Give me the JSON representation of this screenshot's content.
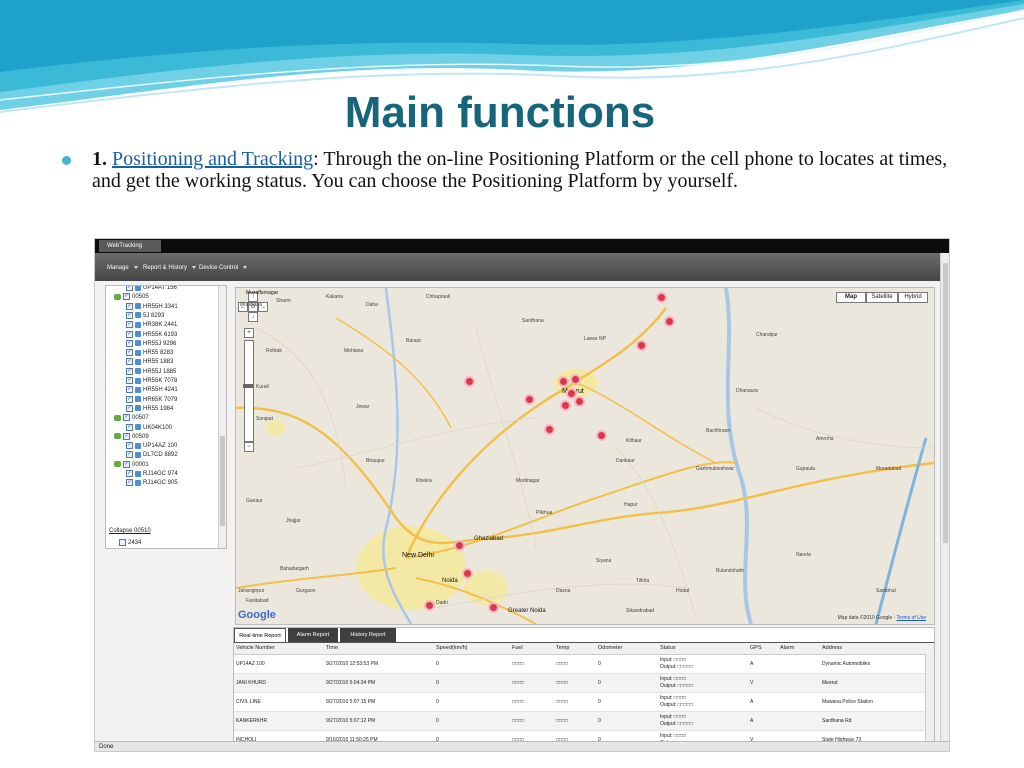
{
  "slide": {
    "title": "Main functions",
    "bullet_number": "1.",
    "bullet_link": "Positioning and Tracking",
    "bullet_text": ": Through the on-line Positioning Platform or the cell phone to locates at times, and get the working status. You can choose the Positioning Platform by yourself."
  },
  "app": {
    "window_tab": "WebTracking",
    "menu": [
      {
        "label": "Manage"
      },
      {
        "label": "Report & History"
      },
      {
        "label": "Device Control"
      }
    ],
    "tree": [
      {
        "label": "UP14AT 156",
        "level": 2,
        "kind": "vehicle"
      },
      {
        "label": "00505",
        "level": 1,
        "kind": "group"
      },
      {
        "label": "HR55H 3341",
        "level": 2,
        "kind": "vehicle"
      },
      {
        "label": "5J 8293",
        "level": 2,
        "kind": "vehicle"
      },
      {
        "label": "HR38K 2441",
        "level": 2,
        "kind": "vehicle"
      },
      {
        "label": "HR55K 6193",
        "level": 2,
        "kind": "vehicle"
      },
      {
        "label": "HR55J 9296",
        "level": 2,
        "kind": "vehicle"
      },
      {
        "label": "HR55 8283",
        "level": 2,
        "kind": "vehicle"
      },
      {
        "label": "HR55 1883",
        "level": 2,
        "kind": "vehicle"
      },
      {
        "label": "HR55J 1885",
        "level": 2,
        "kind": "vehicle"
      },
      {
        "label": "HR55K 7078",
        "level": 2,
        "kind": "vehicle"
      },
      {
        "label": "HR55H 4241",
        "level": 2,
        "kind": "vehicle"
      },
      {
        "label": "HR65K 7079",
        "level": 2,
        "kind": "vehicle"
      },
      {
        "label": "HR55 1984",
        "level": 2,
        "kind": "vehicle"
      },
      {
        "label": "00507",
        "level": 1,
        "kind": "group"
      },
      {
        "label": "UK04K100",
        "level": 2,
        "kind": "vehicle"
      },
      {
        "label": "00509",
        "level": 1,
        "kind": "group"
      },
      {
        "label": "UP14AZ 100",
        "level": 2,
        "kind": "vehicle"
      },
      {
        "label": "DL7CD 8892",
        "level": 2,
        "kind": "vehicle"
      },
      {
        "label": "00001",
        "level": 1,
        "kind": "group"
      },
      {
        "label": "RJ14GC 974",
        "level": 2,
        "kind": "vehicle"
      },
      {
        "label": "RJ14GC 905",
        "level": 2,
        "kind": "vehicle"
      }
    ],
    "collapse_link": "Collapse 00510",
    "collapse_group": "00510",
    "tree_last": "2434",
    "map": {
      "type_buttons": [
        "Map",
        "Satellite",
        "Hybrid"
      ],
      "active_type": "Map",
      "logo": "Google",
      "copyright": "Map data ©2010 Google - ",
      "terms": "Terms of Use",
      "zoom_in": "+",
      "zoom_out": "−",
      "pan_up": "↑",
      "pan_left": "←",
      "pan_right": "→",
      "pan_down": "↓",
      "pan_center": "⊙",
      "cities": [
        "New Delhi",
        "Ghaziabad",
        "Noida",
        "Greater Noida",
        "Meerut",
        "Muzaffarnagar"
      ],
      "places": [
        "Mundlana",
        "Sharm",
        "Kakana",
        "Mehlana",
        "Chhaprauli",
        "Daha",
        "Baraut",
        "Sardhana",
        "Lawar NP",
        "Kithaur",
        "Hapur",
        "Garhmukteshwar",
        "Gajraula",
        "Sonipat",
        "Bahadurgarh",
        "Gurgaon",
        "Faridabad",
        "Dadri",
        "Bulandshahr",
        "Jahangirpur",
        "Rohtak",
        "Jhajjar",
        "Chandpur",
        "Dhanaura",
        "Bachhraon",
        "Amroha",
        "Moradabad",
        "Sambhal",
        "Siyana",
        "Khekra",
        "Modinagar",
        "Pilkhua",
        "Dasna",
        "Jewar",
        "Narela",
        "Hodal",
        "Tilkha",
        "Dankaur",
        "Sikandrabad",
        "Bhaupur",
        "Kurali",
        "Ganaur"
      ]
    },
    "report": {
      "tabs": [
        "Real-time Report",
        "Alarm Report",
        "History Report"
      ],
      "active_tab": "Real-time Report",
      "columns": [
        "Vehicle Number",
        "Time",
        "Speed(km/h)",
        "Fuel",
        "Temp",
        "Odometer",
        "Status",
        "GPS",
        "Alarm",
        "Address"
      ],
      "rows": [
        {
          "vehicle": "UP14AZ 100",
          "time": "9/27/2010 12:53:53 PM",
          "speed": "0",
          "fuel": "□□□□",
          "temp": "□□□□",
          "odo": "0",
          "input": "Input: □□□□",
          "output": "Output: □□□□□",
          "gps": "A",
          "alarm": "",
          "address": "Dynamic Automobiles"
        },
        {
          "vehicle": "JANI KHURD",
          "time": "9/27/2010 5:04:34 PM",
          "speed": "0",
          "fuel": "□□□□",
          "temp": "□□□□",
          "odo": "0",
          "input": "Input: □□□□",
          "output": "Output: □□□□□",
          "gps": "V",
          "alarm": "",
          "address": "Meerut"
        },
        {
          "vehicle": "CIVIL LINE",
          "time": "9/27/2010 5:07:15 PM",
          "speed": "0",
          "fuel": "□□□□",
          "temp": "□□□□",
          "odo": "0",
          "input": "Input: □□□□",
          "output": "Output: □□□□□",
          "gps": "A",
          "alarm": "",
          "address": "Mawana Police Station"
        },
        {
          "vehicle": "KANKERKHR",
          "time": "9/27/2010 5:07:12 PM",
          "speed": "0",
          "fuel": "□□□□",
          "temp": "□□□□",
          "odo": "0",
          "input": "Input: □□□□",
          "output": "Output: □□□□□",
          "gps": "A",
          "alarm": "",
          "address": "Sardhana Rd"
        },
        {
          "vehicle": "INCHOLI",
          "time": "9/16/2010 11:50:25 PM",
          "speed": "0",
          "fuel": "□□□□",
          "temp": "□□□□",
          "odo": "0",
          "input": "Input: □□□□",
          "output": "Output: □□□□□",
          "gps": "V",
          "alarm": "",
          "address": "State Highway 73"
        }
      ]
    },
    "status": "Done"
  },
  "colors": {
    "title": "#17657a",
    "bullet": "#3fb8cf",
    "link": "#1a5ea8",
    "marker": "#d8384a",
    "road_major": "#f2c04a",
    "water": "#a8c6e8",
    "urban": "#f4e99a"
  }
}
